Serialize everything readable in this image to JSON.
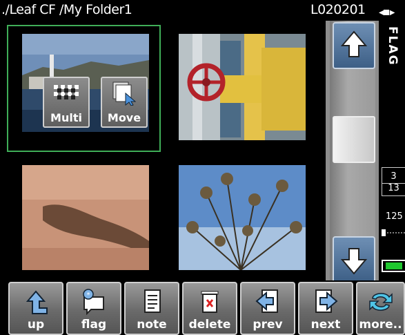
{
  "header": {
    "path": "./Leaf CF /My Folder1",
    "code": "L020201"
  },
  "overlay": {
    "multi_label": "Multi",
    "move_label": "Move"
  },
  "status": {
    "flag_label": "FLAG",
    "count_current": "3",
    "count_total": "13",
    "iso_value": "125",
    "battery_level": 0.85
  },
  "toolbar": {
    "up": "up",
    "flag": "flag",
    "note": "note",
    "delete": "delete",
    "prev": "prev",
    "next": "next",
    "more": "more.."
  },
  "colors": {
    "selection": "#3fae58",
    "scroll_button": "#3d5f86",
    "battery": "#1fc72f"
  }
}
